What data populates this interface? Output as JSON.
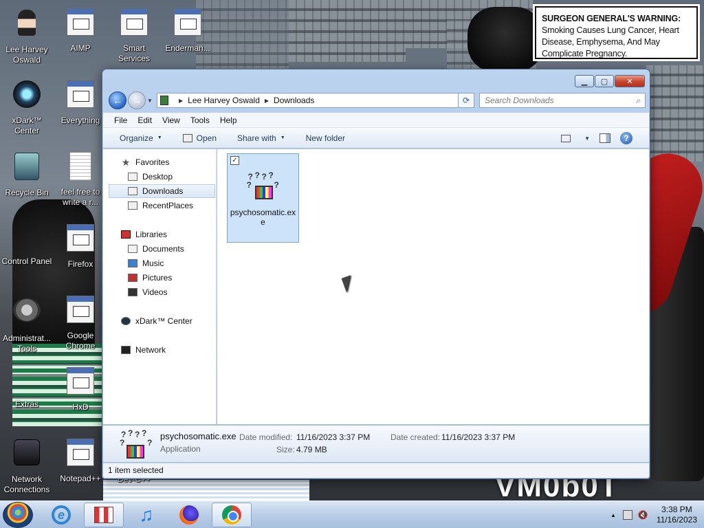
{
  "desktop": {
    "warning": {
      "bold": "SURGEON GENERAL'S WARNING:",
      "text": "Smoking Causes Lung Cancer, Heart Disease, Emphysema, And May Complicate Pregnancy."
    },
    "icons": [
      {
        "label": "Lee Harvey Oswald",
        "icon": "user-folder-icon"
      },
      {
        "label": "AIMP",
        "icon": "aimp-icon"
      },
      {
        "label": "Smart Services",
        "icon": "gear-icon"
      },
      {
        "label": "Enderman...",
        "icon": "document-icon"
      },
      {
        "label": "xDark™ Center",
        "icon": "xdark-icon"
      },
      {
        "label": "Everything",
        "icon": "everything-icon"
      },
      {
        "label": "Recycle Bin",
        "icon": "recycle-bin-icon"
      },
      {
        "label": "feel free to write a r...",
        "icon": "text-file-icon"
      },
      {
        "label": "Control Panel",
        "icon": "control-panel-icon"
      },
      {
        "label": "Firefox",
        "icon": "firefox-icon"
      },
      {
        "label": "Administrat... Tools",
        "icon": "admin-tools-icon"
      },
      {
        "label": "Google Chrome",
        "icon": "chrome-icon"
      },
      {
        "label": "Extras",
        "icon": "folder-icon"
      },
      {
        "label": "HxD",
        "icon": "hxd-icon"
      },
      {
        "label": "Network Connections",
        "icon": "network-icon"
      },
      {
        "label": "Notepad++",
        "icon": "notepadpp-icon"
      },
      {
        "label": "Dev-C++",
        "icon": "devcpp-icon"
      }
    ]
  },
  "window": {
    "breadcrumb": [
      "Lee Harvey Oswald",
      "Downloads"
    ],
    "search_placeholder": "Search Downloads",
    "menu": [
      "File",
      "Edit",
      "View",
      "Tools",
      "Help"
    ],
    "commands": {
      "organize": "Organize",
      "open": "Open",
      "share": "Share with",
      "new_folder": "New folder"
    },
    "nav": {
      "favorites": "Favorites",
      "desktop": "Desktop",
      "downloads": "Downloads",
      "recent": "RecentPlaces",
      "libraries": "Libraries",
      "documents": "Documents",
      "music": "Music",
      "pictures": "Pictures",
      "videos": "Videos",
      "xdark": "xDark™ Center",
      "network": "Network"
    },
    "file": {
      "name": "psychosomatic.exe"
    },
    "details": {
      "name": "psychosomatic.exe",
      "type": "Application",
      "modified_label": "Date modified:",
      "modified": "11/16/2023 3:37 PM",
      "created_label": "Date created:",
      "created": "11/16/2023 3:37 PM",
      "size_label": "Size:",
      "size": "4.79 MB"
    },
    "status": "1 item selected"
  },
  "taskbar": {
    "time": "3:38 PM",
    "date": "11/16/2023"
  }
}
